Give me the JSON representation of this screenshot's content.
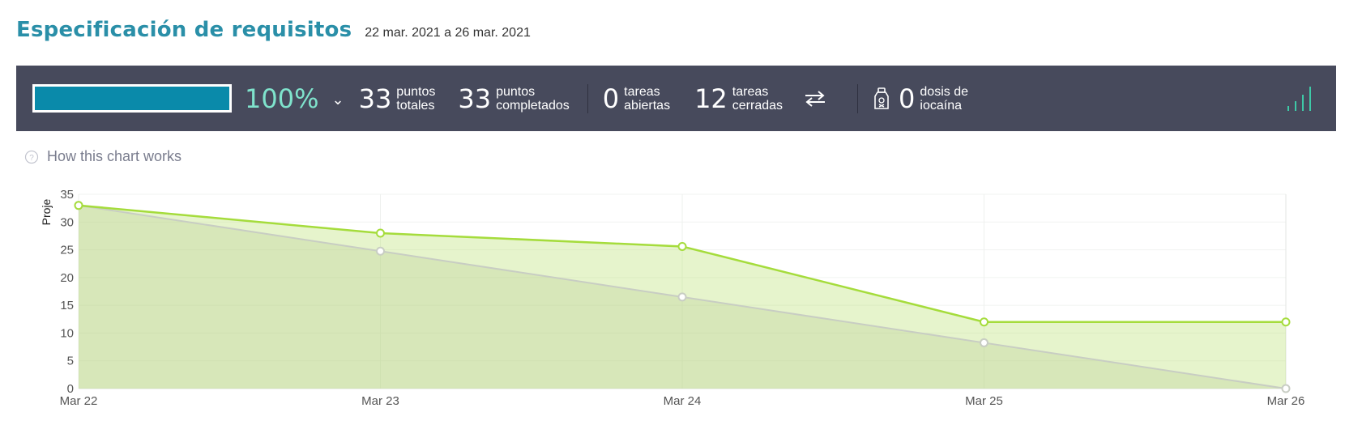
{
  "header": {
    "title": "Especificación de requisitos",
    "dates": "22 mar. 2021 a 26 mar. 2021"
  },
  "stats": {
    "progress_percent": 100,
    "progress_label": "100%",
    "chevron": "⌄",
    "total_points": "33",
    "total_points_label1": "puntos",
    "total_points_label2": "totales",
    "completed_points": "33",
    "completed_points_label1": "puntos",
    "completed_points_label2": "completados",
    "open_tasks": "0",
    "open_tasks_label1": "tareas",
    "open_tasks_label2": "abiertas",
    "closed_tasks": "12",
    "closed_tasks_label1": "tareas",
    "closed_tasks_label2": "cerradas",
    "iocaine": "0",
    "iocaine_label1": "dosis de",
    "iocaine_label2": "iocaína"
  },
  "help": {
    "label": "How this chart works"
  },
  "colors": {
    "title": "#2a8fa8",
    "bar_bg": "#474a5c",
    "progress": "#0a8aaa",
    "percent": "#7fe3cc",
    "real_line": "#a5dc3c",
    "optimal_line": "#c8cdc3"
  },
  "chart_data": {
    "type": "area",
    "ylabel": "Proje",
    "ylim": [
      0,
      35
    ],
    "yticks": [
      "0",
      "5",
      "10",
      "15",
      "20",
      "25",
      "30",
      "35"
    ],
    "categories": [
      "Mar 22",
      "Mar 23",
      "Mar 24",
      "Mar 25",
      "Mar 26"
    ],
    "series": [
      {
        "values": [
          33,
          28,
          25.6,
          12,
          12
        ],
        "color": "#a5dc3c"
      },
      {
        "values": [
          33,
          24.75,
          16.5,
          8.25,
          0
        ],
        "color": "#c8cdc3"
      }
    ]
  }
}
